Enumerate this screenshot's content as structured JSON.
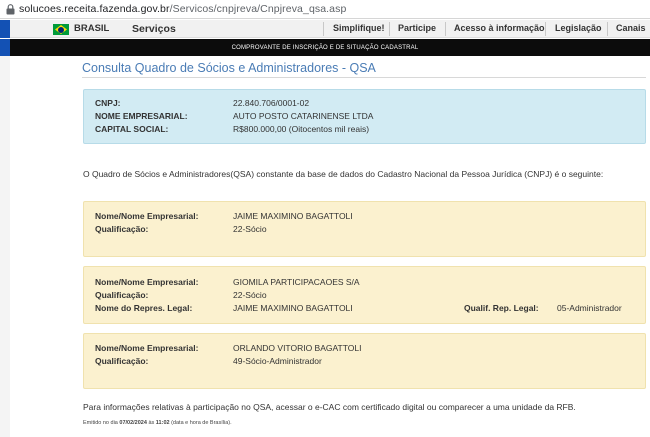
{
  "browser": {
    "url_host": "solucoes.receita.fazenda.gov.br",
    "url_path": "/Servicos/cnpjreva/Cnpjreva_qsa.asp"
  },
  "gov_bar": {
    "brasil": "BRASIL",
    "servicos": "Serviços",
    "nav": [
      "Simplifique!",
      "Participe",
      "Acesso à informação",
      "Legislação",
      "Canais"
    ]
  },
  "banner": "COMPROVANTE DE INSCRIÇÃO E DE SITUAÇÃO CADASTRAL",
  "page_title": "Consulta Quadro de Sócios e Administradores - QSA",
  "company": {
    "cnpj_label": "CNPJ:",
    "cnpj": "22.840.706/0001-02",
    "nome_label": "NOME EMPRESARIAL:",
    "nome": "AUTO POSTO CATARINENSE LTDA",
    "capital_label": "CAPITAL SOCIAL:",
    "capital": "R$800.000,00 (Oitocentos mil reais)"
  },
  "intro": "O Quadro de Sócios e Administradores(QSA) constante da base de dados do Cadastro Nacional da Pessoa Jurídica (CNPJ) é o seguinte:",
  "partners": [
    {
      "nome_label": "Nome/Nome Empresarial:",
      "nome": "JAIME MAXIMINO BAGATTOLI",
      "qual_label": "Qualificação:",
      "qual": "22-Sócio"
    },
    {
      "nome_label": "Nome/Nome Empresarial:",
      "nome": "GIOMILA PARTICIPACAOES S/A",
      "qual_label": "Qualificação:",
      "qual": "22-Sócio",
      "repr_label": "Nome do Repres. Legal:",
      "repr": "JAIME MAXIMINO BAGATTOLI",
      "qual_rep_label": "Qualif. Rep. Legal:",
      "qual_rep": "05-Administrador"
    },
    {
      "nome_label": "Nome/Nome Empresarial:",
      "nome": "ORLANDO VITORIO BAGATTOLI",
      "qual_label": "Qualificação:",
      "qual": "49-Sócio-Administrador"
    }
  ],
  "footer": "Para informações relativas à participação no QSA, acessar o e-CAC com certificado digital ou comparecer a uma unidade da RFB.",
  "emitted": {
    "prefix": "Emitido no dia ",
    "date": "07/02/2024",
    "middle": " às ",
    "time": "11:02",
    "suffix": " (data e hora de Brasília)."
  },
  "colors": {
    "title": "#4a7cb5",
    "info_box": "#d2ebf3",
    "partner_box": "#fbf1cf",
    "gov_blue": "#1351b4"
  }
}
